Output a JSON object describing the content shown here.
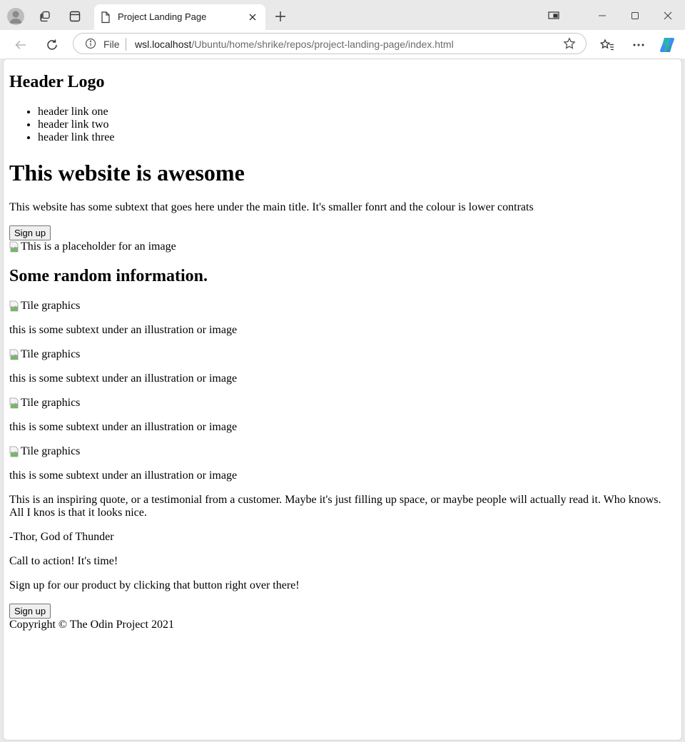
{
  "browser": {
    "tab_title": "Project Landing Page",
    "address_scheme": "File",
    "address_host": "wsl.localhost",
    "address_path": "/Ubuntu/home/shrike/repos/project-landing-page/index.html"
  },
  "header": {
    "logo": "Header Logo",
    "links": [
      "header link one",
      "header link two",
      "header link three"
    ]
  },
  "hero": {
    "title": "This website is awesome",
    "subtext": "This website has some subtext that goes here under the main title. It's smaller fonrt and the colour is lower contrats",
    "signup_label": "Sign up",
    "image_alt": "This is a placeholder for an image"
  },
  "info": {
    "heading": "Some random information.",
    "tiles": [
      {
        "alt": "Tile graphics",
        "text": "this is some subtext under an illustration or image"
      },
      {
        "alt": "Tile graphics",
        "text": "this is some subtext under an illustration or image"
      },
      {
        "alt": "Tile graphics",
        "text": "this is some subtext under an illustration or image"
      },
      {
        "alt": "Tile graphics",
        "text": "this is some subtext under an illustration or image"
      }
    ]
  },
  "quote": {
    "text": "This is an inspiring quote, or a testimonial from a customer. Maybe it's just filling up space, or maybe people will actually read it. Who knows. All I knos is that it looks nice.",
    "author": "-Thor, God of Thunder"
  },
  "cta": {
    "title": "Call to action! It's time!",
    "text": "Sign up for our product by clicking that button right over there!",
    "signup_label": "Sign up"
  },
  "footer": {
    "copyright": "Copyright © The Odin Project 2021"
  }
}
